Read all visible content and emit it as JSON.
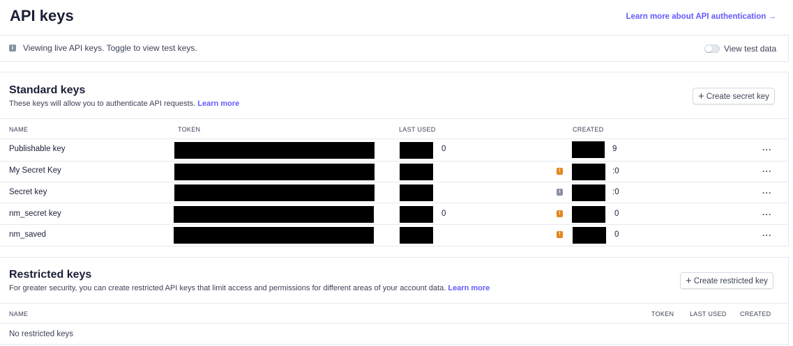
{
  "header": {
    "title": "API keys",
    "learn_link": "Learn more about API authentication",
    "learn_arrow": "→"
  },
  "banner": {
    "text": "Viewing live API keys. Toggle to view test keys.",
    "toggle_label": "View test data"
  },
  "standard": {
    "title": "Standard keys",
    "desc": "These keys will allow you to authenticate API requests.",
    "desc_link": "Learn more",
    "create_button": "Create secret key",
    "columns": {
      "name": "NAME",
      "token": "TOKEN",
      "last_used": "LAST USED",
      "created": "CREATED"
    },
    "rows": [
      {
        "name": "Publishable key",
        "last_used_tail": "0",
        "created_tail": "9"
      },
      {
        "name": "My Secret Key",
        "last_used_tail": "",
        "created_tail": ":0"
      },
      {
        "name": "Secret key",
        "last_used_tail": "",
        "created_tail": ":0"
      },
      {
        "name": "nm_secret key",
        "last_used_tail": "0",
        "created_tail": "0"
      },
      {
        "name": "nm_saved",
        "last_used_tail": "",
        "created_tail": "0"
      }
    ],
    "more_glyph": "···"
  },
  "restricted": {
    "title": "Restricted keys",
    "desc": "For greater security, you can create restricted API keys that limit access and permissions for different areas of your account data.",
    "desc_link": "Learn more",
    "create_button": "Create restricted key",
    "columns": {
      "name": "NAME",
      "token": "TOKEN",
      "last_used": "LAST USED",
      "created": "CREATED"
    },
    "empty": "No restricted keys"
  }
}
